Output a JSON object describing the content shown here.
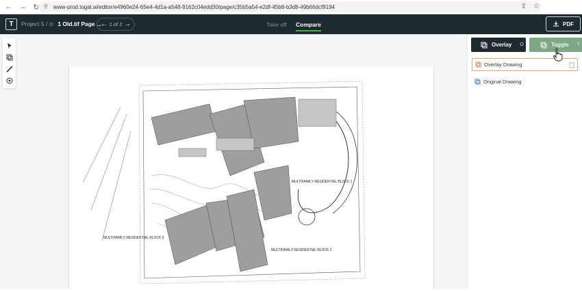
{
  "browser": {
    "url": "www-prod.togal.ai/editor/e4960e24-65e4-4d1a-a548-9162c04edd30/page/c35b5a54-e2df-45b8-b3d8-49b66dcf9194"
  },
  "app": {
    "logo_letter": "T",
    "project_label": "Project 5 / ",
    "file_name": "1 Old.tif Page ...",
    "pager_text": "1 of 2",
    "tabs": [
      {
        "label": "Take off",
        "active": false
      },
      {
        "label": "Compare",
        "active": true
      }
    ],
    "pdf_label": "PDF"
  },
  "panel": {
    "overlay_btn": {
      "label": "Overlay",
      "shortcut": "O"
    },
    "toggle_btn": {
      "label": "Toggle",
      "shortcut": "T"
    },
    "layers": [
      {
        "label": "Overlay Drawing",
        "selected": true
      },
      {
        "label": "Original Drawing",
        "selected": false
      }
    ]
  },
  "drawing_labels": {
    "block1": "MULTIFAMILY RESIDENTIAL BLOCK 1",
    "block2": "MULTIFAMILY RESIDENTIAL BLOCK 2",
    "block3": "MULTIFAMILY RESIDENTIAL BLOCK 3"
  },
  "colors": {
    "appbar": "#1f2a2e",
    "accent_green": "#4caf50",
    "toggle_green": "#7fa887",
    "overlay_border": "#e8a07a"
  }
}
